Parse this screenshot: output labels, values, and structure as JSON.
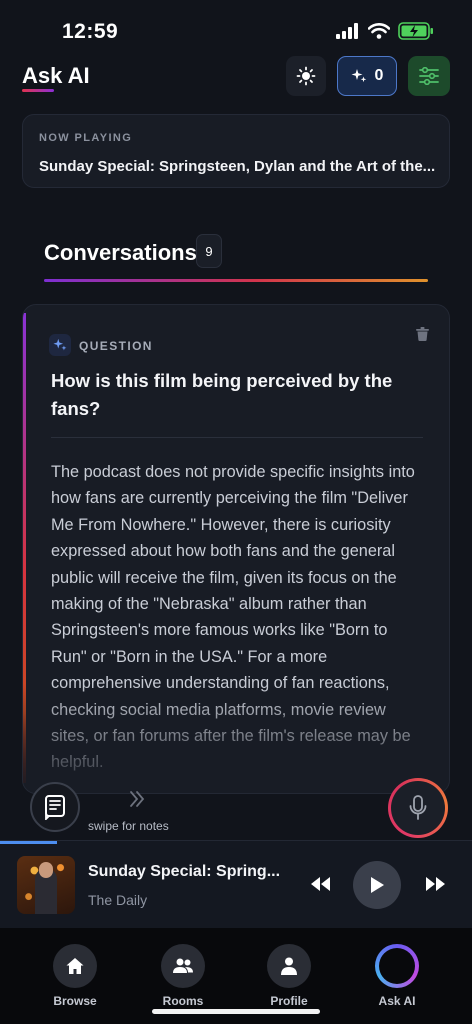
{
  "status": {
    "time": "12:59"
  },
  "header": {
    "title": "Ask AI",
    "credits": "0"
  },
  "now_playing": {
    "label": "NOW PLAYING",
    "title": "Sunday Special: Springsteen, Dylan and the Art of the..."
  },
  "conversations": {
    "title": "Conversations",
    "count": "9"
  },
  "card": {
    "question_label": "QUESTION",
    "question": "How is this film being perceived by the fans?",
    "answer": "The podcast does not provide specific insights into how fans are currently perceiving the film \"Deliver Me From Nowhere.\" However, there is curiosity expressed about how both fans and the general public will receive the film, given its focus on the making of the \"Nebraska\" album rather than Springsteen's more famous works like \"Born to Run\" or \"Born in the USA.\" For a more comprehensive understanding of fan reactions, checking social media platforms, movie review sites, or fan forums after the film's release may be helpful."
  },
  "notes": {
    "swipe_label": "swipe for notes"
  },
  "player": {
    "title": "Sunday Special: Spring...",
    "subtitle": "The Daily",
    "progress": 0.12
  },
  "tabs": [
    {
      "label": "Browse",
      "icon": "home-icon"
    },
    {
      "label": "Rooms",
      "icon": "people-icon"
    },
    {
      "label": "Profile",
      "icon": "person-icon"
    },
    {
      "label": "Ask AI",
      "icon": "ai-ring-icon"
    }
  ],
  "colors": {
    "accent_blue": "#4d8ef0",
    "settings_green": "#4fbf6a",
    "mic_ring": "#e23a66"
  }
}
